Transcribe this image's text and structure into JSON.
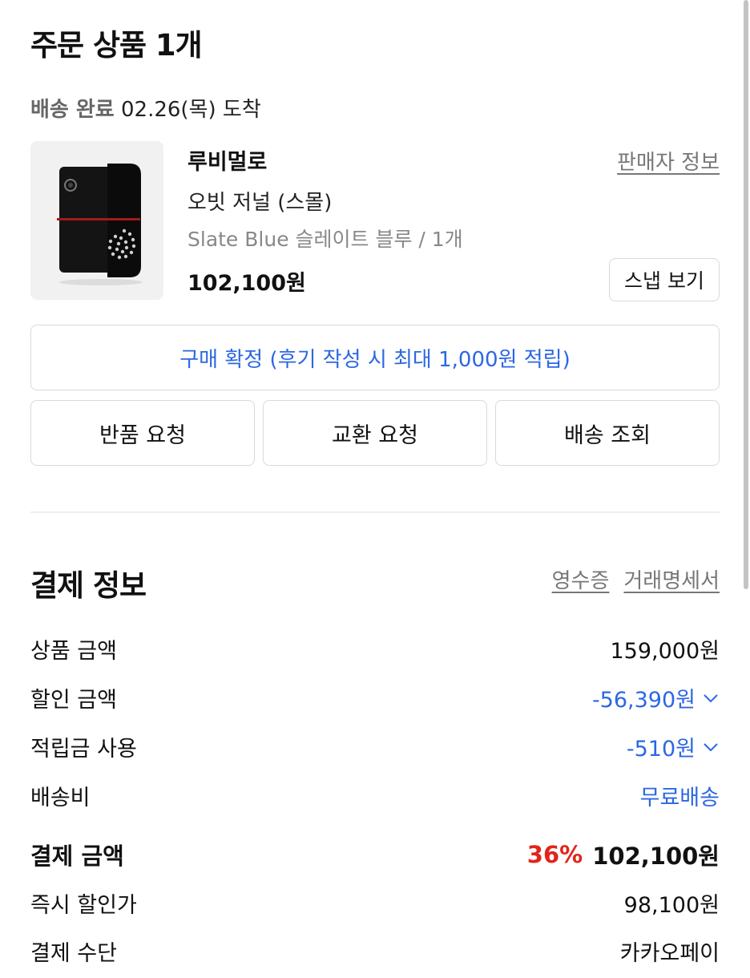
{
  "order": {
    "title": "주문 상품 1개",
    "delivery_status": "배송 완료",
    "delivery_date": "02.26(목) 도착"
  },
  "product": {
    "brand": "루비멀로",
    "name": "오빗 저널 (스몰)",
    "option": "Slate Blue 슬레이트 블루 / 1개",
    "price": "102,100원",
    "seller_info_label": "판매자 정보",
    "snap_label": "스냅 보기",
    "image_icon": "journal-product-photo"
  },
  "actions": {
    "confirm_label": "구매 확정 (후기 작성 시 최대 1,000원 적립)",
    "return_label": "반품 요청",
    "exchange_label": "교환 요청",
    "tracking_label": "배송 조회"
  },
  "payment": {
    "title": "결제 정보",
    "receipt_label": "영수증",
    "statement_label": "거래명세서",
    "rows": [
      {
        "label": "상품 금액",
        "value": "159,000원"
      },
      {
        "label": "할인 금액",
        "value": "-56,390원"
      },
      {
        "label": "적립금 사용",
        "value": "-510원"
      },
      {
        "label": "배송비",
        "value": "무료배송"
      },
      {
        "label": "결제 금액",
        "percent": "36%",
        "value": "102,100원"
      },
      {
        "label": "즉시 할인가",
        "value": "98,100원"
      },
      {
        "label": "결제 수단",
        "value": "카카오페이"
      }
    ]
  },
  "colors": {
    "accent_blue": "#2c67e3",
    "discount_red": "#e1251b",
    "muted_text": "#777777"
  }
}
